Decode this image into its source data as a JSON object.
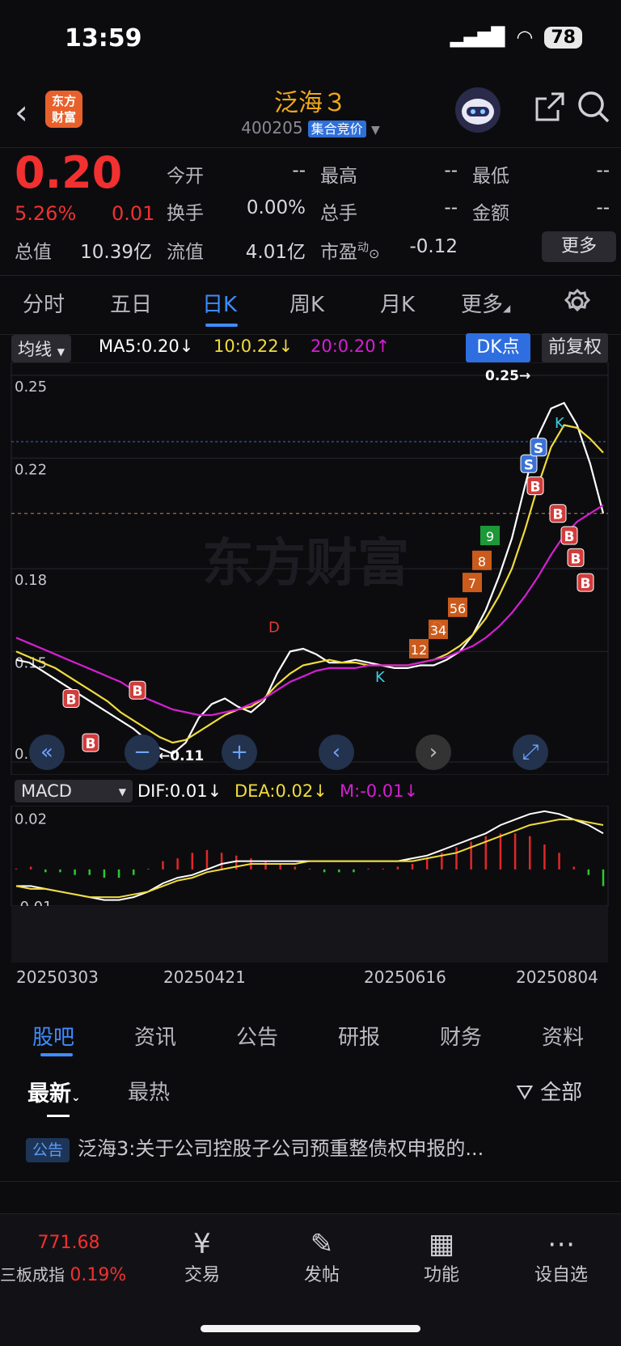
{
  "status": {
    "time": "13:59",
    "battery": "78"
  },
  "header": {
    "logo_line1": "东方",
    "logo_line2": "财富",
    "name": "泛海３",
    "code": "400205",
    "session": "集合竞价"
  },
  "quote": {
    "price": "0.20",
    "pct": "5.26%",
    "change": "0.01",
    "open_label": "今开",
    "open": "--",
    "high_label": "最高",
    "high": "--",
    "low_label": "最低",
    "low": "--",
    "turnover_label": "换手",
    "turnover": "0.00%",
    "volume_label": "总手",
    "volume": "--",
    "amount_label": "金额",
    "amount": "--",
    "mcap_label": "总值",
    "mcap": "10.39亿",
    "float_label": "流值",
    "float": "4.01亿",
    "pe_label": "市盈",
    "pe_sup": "动",
    "pe": "-0.12",
    "more": "更多"
  },
  "tabs": [
    "分时",
    "五日",
    "日K",
    "周K",
    "月K",
    "更多"
  ],
  "ma": {
    "selector": "均线",
    "ma5": "MA5:0.20",
    "ma10": "10:0.22",
    "ma20": "20:0.20",
    "dk": "DK点",
    "fq": "前复权"
  },
  "macd": {
    "selector": "MACD",
    "dif": "DIF:0.01",
    "dea": "DEA:0.02",
    "m": "M:-0.01"
  },
  "chart_data": {
    "type": "line",
    "title": "",
    "y_ticks": [
      "0.25",
      "0.22",
      "0.18",
      "0.15",
      "0.11"
    ],
    "ylim": [
      0.11,
      0.25
    ],
    "max_label": "0.25",
    "min_label": "0.11",
    "x_dates": [
      "20250303",
      "20250421",
      "20250616",
      "20250804"
    ],
    "series": [
      {
        "name": "MA5",
        "color": "#ffffff",
        "values": [
          0.147,
          0.146,
          0.143,
          0.14,
          0.137,
          0.134,
          0.131,
          0.128,
          0.125,
          0.122,
          0.118,
          0.115,
          0.113,
          0.117,
          0.126,
          0.131,
          0.133,
          0.13,
          0.128,
          0.132,
          0.142,
          0.15,
          0.151,
          0.149,
          0.146,
          0.146,
          0.147,
          0.146,
          0.145,
          0.144,
          0.144,
          0.145,
          0.145,
          0.147,
          0.15,
          0.156,
          0.165,
          0.177,
          0.191,
          0.21,
          0.228,
          0.238,
          0.24,
          0.232,
          0.218,
          0.2
        ]
      },
      {
        "name": "MA10",
        "color": "#f0dc3c",
        "values": [
          0.15,
          0.148,
          0.146,
          0.144,
          0.141,
          0.138,
          0.135,
          0.132,
          0.128,
          0.125,
          0.122,
          0.119,
          0.117,
          0.118,
          0.121,
          0.124,
          0.127,
          0.129,
          0.13,
          0.133,
          0.138,
          0.142,
          0.145,
          0.146,
          0.147,
          0.146,
          0.146,
          0.145,
          0.145,
          0.145,
          0.145,
          0.146,
          0.147,
          0.149,
          0.152,
          0.156,
          0.162,
          0.17,
          0.18,
          0.194,
          0.21,
          0.224,
          0.232,
          0.231,
          0.227,
          0.222
        ]
      },
      {
        "name": "MA20",
        "color": "#d61fd2",
        "values": [
          0.155,
          0.153,
          0.151,
          0.149,
          0.147,
          0.145,
          0.143,
          0.141,
          0.139,
          0.136,
          0.133,
          0.131,
          0.129,
          0.128,
          0.127,
          0.127,
          0.128,
          0.129,
          0.131,
          0.133,
          0.136,
          0.139,
          0.141,
          0.143,
          0.144,
          0.144,
          0.144,
          0.145,
          0.145,
          0.145,
          0.145,
          0.146,
          0.147,
          0.148,
          0.15,
          0.152,
          0.155,
          0.159,
          0.164,
          0.17,
          0.177,
          0.185,
          0.192,
          0.197,
          0.2,
          0.203
        ]
      }
    ],
    "macd_ylim": [
      -0.012,
      0.023
    ],
    "macd_ticks": [
      "0.02",
      "-0.01"
    ],
    "dif": [
      -0.006,
      -0.006,
      -0.007,
      -0.008,
      -0.009,
      -0.01,
      -0.011,
      -0.011,
      -0.01,
      -0.008,
      -0.005,
      -0.003,
      -0.002,
      0.0,
      0.002,
      0.003,
      0.003,
      0.003,
      0.003,
      0.003,
      0.003,
      0.003,
      0.003,
      0.003,
      0.003,
      0.003,
      0.003,
      0.004,
      0.005,
      0.007,
      0.009,
      0.011,
      0.013,
      0.016,
      0.018,
      0.02,
      0.021,
      0.02,
      0.018,
      0.016,
      0.013
    ],
    "dea": [
      -0.006,
      -0.007,
      -0.007,
      -0.008,
      -0.009,
      -0.01,
      -0.01,
      -0.01,
      -0.009,
      -0.008,
      -0.006,
      -0.004,
      -0.003,
      -0.001,
      0.0,
      0.001,
      0.002,
      0.002,
      0.002,
      0.002,
      0.003,
      0.003,
      0.003,
      0.003,
      0.003,
      0.003,
      0.003,
      0.003,
      0.004,
      0.005,
      0.006,
      0.008,
      0.01,
      0.012,
      0.014,
      0.016,
      0.017,
      0.018,
      0.018,
      0.017,
      0.016
    ],
    "hist": [
      0.0,
      0.001,
      -0.001,
      -0.001,
      -0.002,
      -0.002,
      -0.003,
      -0.003,
      -0.002,
      0.0,
      0.003,
      0.004,
      0.006,
      0.007,
      0.006,
      0.005,
      0.004,
      0.003,
      0.002,
      0.001,
      0.0,
      -0.001,
      -0.001,
      -0.001,
      0.0,
      0.0,
      0.001,
      0.002,
      0.004,
      0.006,
      0.008,
      0.01,
      0.012,
      0.013,
      0.013,
      0.012,
      0.009,
      0.006,
      0.001,
      -0.002,
      -0.006
    ]
  },
  "markers": {
    "d": "D",
    "k": "K",
    "s": "S",
    "b": "B",
    "counts": [
      "12",
      "34",
      "56",
      "7",
      "8",
      "9"
    ]
  },
  "bottom_tabs": [
    "股吧",
    "资讯",
    "公告",
    "研报",
    "财务",
    "资料"
  ],
  "filters": {
    "latest": "最新",
    "hot": "最热",
    "all": "全部"
  },
  "news": {
    "tag": "公告",
    "text": "泛海3:关于公司控股子公司预重整债权申报的..."
  },
  "dock": {
    "index_value": "771.68",
    "index_name": "三板成指",
    "index_pct": "0.19%",
    "trade": "交易",
    "post": "发帖",
    "func": "功能",
    "watch": "设自选"
  },
  "colors": {
    "up": "#f23030",
    "down": "#3cc83c",
    "accent": "#3f8cff",
    "name": "#f0a818"
  }
}
